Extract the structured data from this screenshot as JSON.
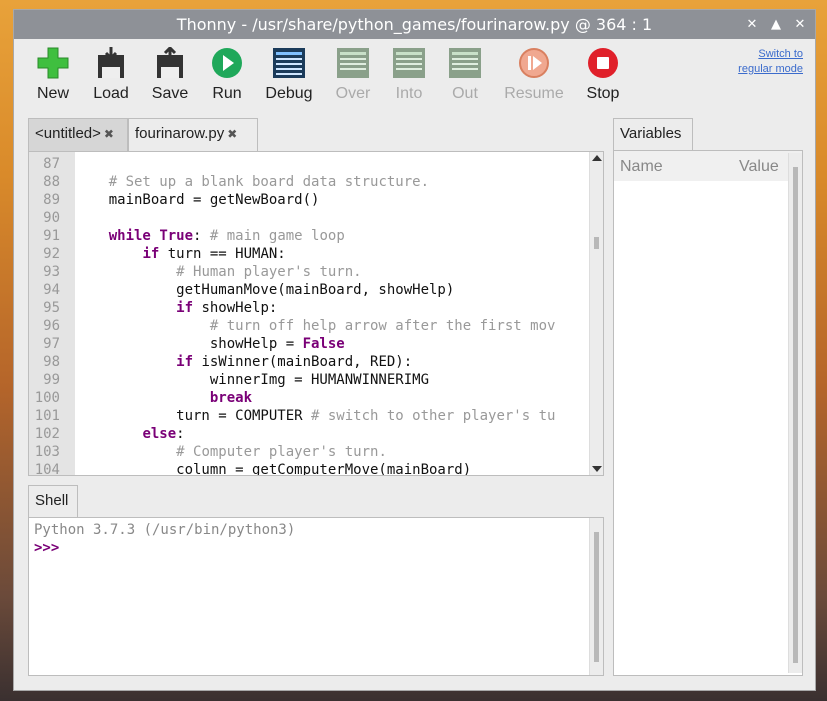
{
  "window": {
    "title": "Thonny  -  /usr/share/python_games/fourinarow.py  @  364 : 1",
    "buttons": [
      "×",
      "^",
      "×"
    ]
  },
  "toolbar": {
    "new": "New",
    "load": "Load",
    "save": "Save",
    "run": "Run",
    "debug": "Debug",
    "over": "Over",
    "into": "Into",
    "out": "Out",
    "resume": "Resume",
    "stop": "Stop",
    "switch_line1": "Switch to",
    "switch_line2": "regular mode"
  },
  "editor": {
    "tabs": [
      "<untitled>",
      "fourinarow.py"
    ],
    "close_glyph": "✖",
    "lines": [
      {
        "n": "87",
        "html": ""
      },
      {
        "n": "88",
        "html": "    <span class='cm'># Set up a blank board data structure.</span>"
      },
      {
        "n": "89",
        "html": "    mainBoard = getNewBoard()"
      },
      {
        "n": "90",
        "html": ""
      },
      {
        "n": "91",
        "html": "    <span class='kw'>while</span> <span class='kw'>True</span>: <span class='cm'># main game loop</span>"
      },
      {
        "n": "92",
        "html": "        <span class='kw'>if</span> turn == HUMAN:"
      },
      {
        "n": "93",
        "html": "            <span class='cm'># Human player's turn.</span>"
      },
      {
        "n": "94",
        "html": "            getHumanMove(mainBoard, showHelp)"
      },
      {
        "n": "95",
        "html": "            <span class='kw'>if</span> showHelp:"
      },
      {
        "n": "96",
        "html": "                <span class='cm'># turn off help arrow after the first mov</span>"
      },
      {
        "n": "97",
        "html": "                showHelp = <span class='kw'>False</span>"
      },
      {
        "n": "98",
        "html": "            <span class='kw'>if</span> isWinner(mainBoard, RED):"
      },
      {
        "n": "99",
        "html": "                winnerImg = HUMANWINNERIMG"
      },
      {
        "n": "100",
        "html": "                <span class='kw'>break</span>"
      },
      {
        "n": "101",
        "html": "            turn = COMPUTER <span class='cm'># switch to other player's tu</span>"
      },
      {
        "n": "102",
        "html": "        <span class='kw'>else</span>:"
      },
      {
        "n": "103",
        "html": "            <span class='cm'># Computer player's turn.</span>"
      },
      {
        "n": "104",
        "html": "            column = getComputerMove(mainBoard)"
      }
    ]
  },
  "shell": {
    "tab": "Shell",
    "line1": "Python 3.7.3 (/usr/bin/python3)",
    "prompt": ">>>"
  },
  "variables": {
    "tab": "Variables",
    "col_name": "Name",
    "col_value": "Value"
  },
  "colors": {
    "keyword": "#7a0077",
    "comment": "#999999",
    "prompt": "#7a0077",
    "titlebar": "#8e9197"
  },
  "icons": [
    "plus-icon",
    "floppy-load-icon",
    "floppy-save-icon",
    "run-icon",
    "debug-icon",
    "step-over-icon",
    "step-into-icon",
    "step-out-icon",
    "resume-icon",
    "stop-icon"
  ]
}
